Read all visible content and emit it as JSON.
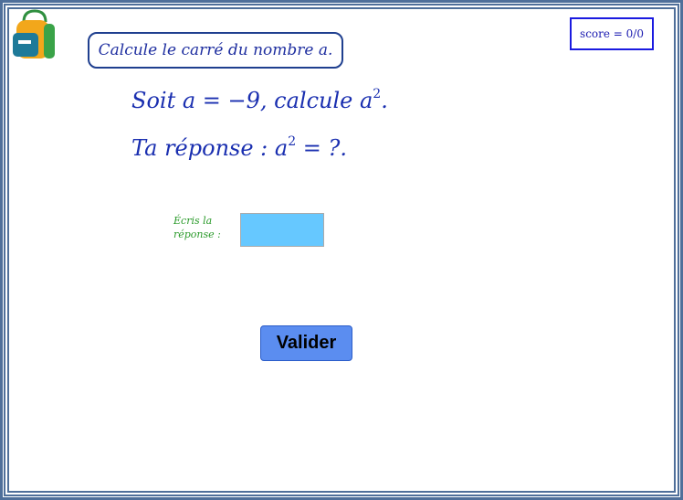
{
  "header": {
    "instruction": "Calcule le carré du nombre a.",
    "score": "score = 0/0",
    "icon": "backpack-icon"
  },
  "question": {
    "line1_prefix": "Soit a = −9,  calcule a",
    "line1_exponent": "2",
    "line1_suffix": ".",
    "line2_prefix": "Ta réponse : a",
    "line2_exponent": "2",
    "line2_suffix": " = ?."
  },
  "answer": {
    "label_line1": "Écris la",
    "label_line2": "réponse :",
    "value": ""
  },
  "actions": {
    "submit_label": "Valider"
  },
  "colors": {
    "frame": "#4f6f9a",
    "math_text": "#1a2fb0",
    "input_bg": "#66c8ff",
    "button_bg": "#5b8df0",
    "label_green": "#2a9a2a"
  }
}
